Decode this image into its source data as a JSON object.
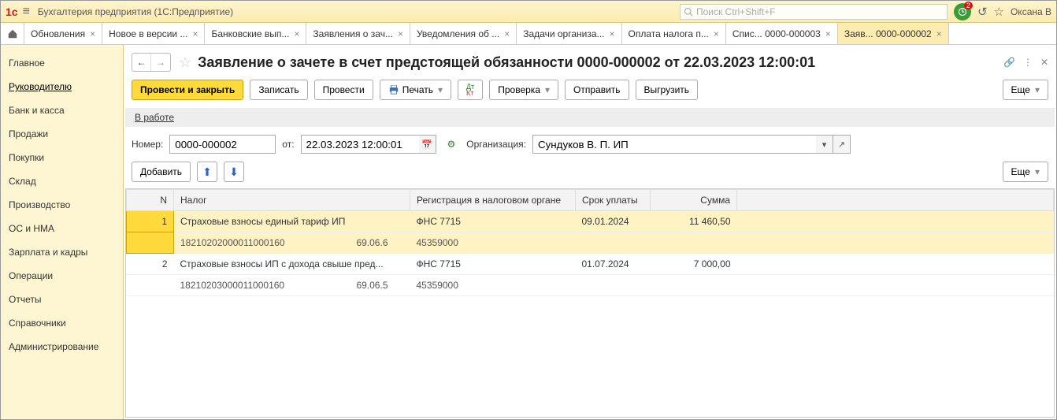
{
  "titlebar": {
    "app_title": "Бухгалтерия предприятия  (1С:Предприятие)",
    "search_placeholder": "Поиск Ctrl+Shift+F",
    "notif_count": "2",
    "username": "Оксана В"
  },
  "tabs": [
    {
      "label": "Обновления"
    },
    {
      "label": "Новое в версии ..."
    },
    {
      "label": "Банковские вып..."
    },
    {
      "label": "Заявления о зач..."
    },
    {
      "label": "Уведомления об ..."
    },
    {
      "label": "Задачи организа..."
    },
    {
      "label": "Оплата налога п..."
    },
    {
      "label": "Спис... 0000-000003"
    },
    {
      "label": "Заяв... 0000-000002",
      "active": true
    }
  ],
  "sidebar": [
    "Главное",
    "Руководителю",
    "Банк и касса",
    "Продажи",
    "Покупки",
    "Склад",
    "Производство",
    "ОС и НМА",
    "Зарплата и кадры",
    "Операции",
    "Отчеты",
    "Справочники",
    "Администрирование"
  ],
  "sidebar_active": 1,
  "doc": {
    "title": "Заявление о зачете в счет предстоящей обязанности 0000-000002 от 22.03.2023 12:00:01"
  },
  "toolbar": {
    "post_close": "Провести и закрыть",
    "save": "Записать",
    "post": "Провести",
    "print": "Печать",
    "check": "Проверка",
    "send": "Отправить",
    "export": "Выгрузить",
    "more": "Еще"
  },
  "status": {
    "label": "В работе"
  },
  "form": {
    "number_label": "Номер:",
    "number": "0000-000002",
    "from_label": "от:",
    "date": "22.03.2023 12:00:01",
    "org_label": "Организация:",
    "org": "Сундуков В. П. ИП"
  },
  "addbar": {
    "add": "Добавить",
    "more": "Еще"
  },
  "table": {
    "headers": {
      "n": "N",
      "tax": "Налог",
      "reg": "Регистрация в налоговом органе",
      "due": "Срок уплаты",
      "sum": "Сумма"
    },
    "rows": [
      {
        "n": "1",
        "tax": "Страховые взносы единый тариф ИП",
        "reg": "ФНС 7715",
        "due": "09.01.2024",
        "sum": "11 460,50",
        "kbk": "18210202000011000160",
        "acc": "69.06.6",
        "oktmo": "45359000",
        "selected": true
      },
      {
        "n": "2",
        "tax": "Страховые взносы ИП с дохода свыше пред...",
        "reg": "ФНС 7715",
        "due": "01.07.2024",
        "sum": "7 000,00",
        "kbk": "18210203000011000160",
        "acc": "69.06.5",
        "oktmo": "45359000"
      }
    ]
  }
}
